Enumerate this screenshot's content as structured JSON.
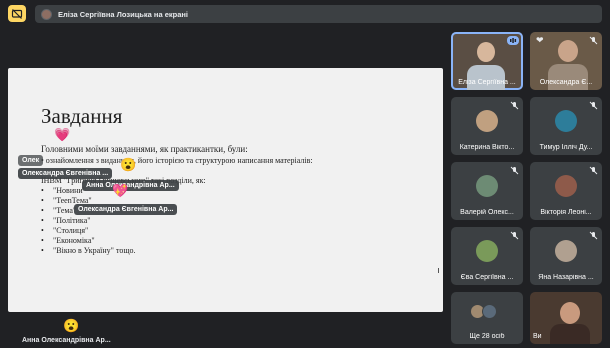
{
  "header": {
    "presenting_text": "Еліза Сергіївна Лозицька на екрані",
    "present_icon": "present-off-icon",
    "accent": "#fdd663"
  },
  "slide": {
    "title": "Завдання",
    "intro": "Головними моїми завданнями, як практикантки, були:",
    "line1": "• ознайомлення з виданням, його історією та структурою написання матеріалів:",
    "line2": "ІНВМ \"Григорія Грушевського\" такі розділи, як:",
    "bullets": [
      "\"Новини\"",
      "\"TeenТема\"",
      "\"Тема\"",
      "\"Політика\"",
      "\"Столиця\"",
      "\"Економіка\"",
      "\"Вікно в Україну\" тощо."
    ]
  },
  "reactions": {
    "chip1": "Олександра Євгенівна ...",
    "chip2": "Анна Олександрівна Ар...",
    "chip3": "Олександра Євгенівна Ар...",
    "chip_partial": "Олек",
    "emoji_heart": "💗",
    "emoji_wow": "😮",
    "emoji_heart2": "💖"
  },
  "participants": [
    {
      "name": "Еліза Сергіївна ...",
      "type": "video",
      "active": true
    },
    {
      "name": "Олександра Є...",
      "type": "video",
      "active": false
    },
    {
      "name": "Катерина Вікто...",
      "type": "avatar",
      "color": "#c0a080"
    },
    {
      "name": "Тимур Ілліч Ду...",
      "type": "avatar",
      "color": "#2d7d9a"
    },
    {
      "name": "Валерій Олекс...",
      "type": "avatar",
      "color": "#6d8b74"
    },
    {
      "name": "Вікторія Леоні...",
      "type": "avatar",
      "color": "#8e5a4a"
    },
    {
      "name": "Єва Сергіївна ...",
      "type": "avatar",
      "color": "#7a9a5a"
    },
    {
      "name": "Яна Назарівна ...",
      "type": "avatar",
      "color": "#b0a090"
    },
    {
      "name": "Ще 28 осіб",
      "type": "more"
    },
    {
      "name": "Ви",
      "type": "video",
      "active": false
    }
  ],
  "bottom_reaction": {
    "name": "Анна Олександрівна Ар...",
    "emoji": "😮"
  }
}
